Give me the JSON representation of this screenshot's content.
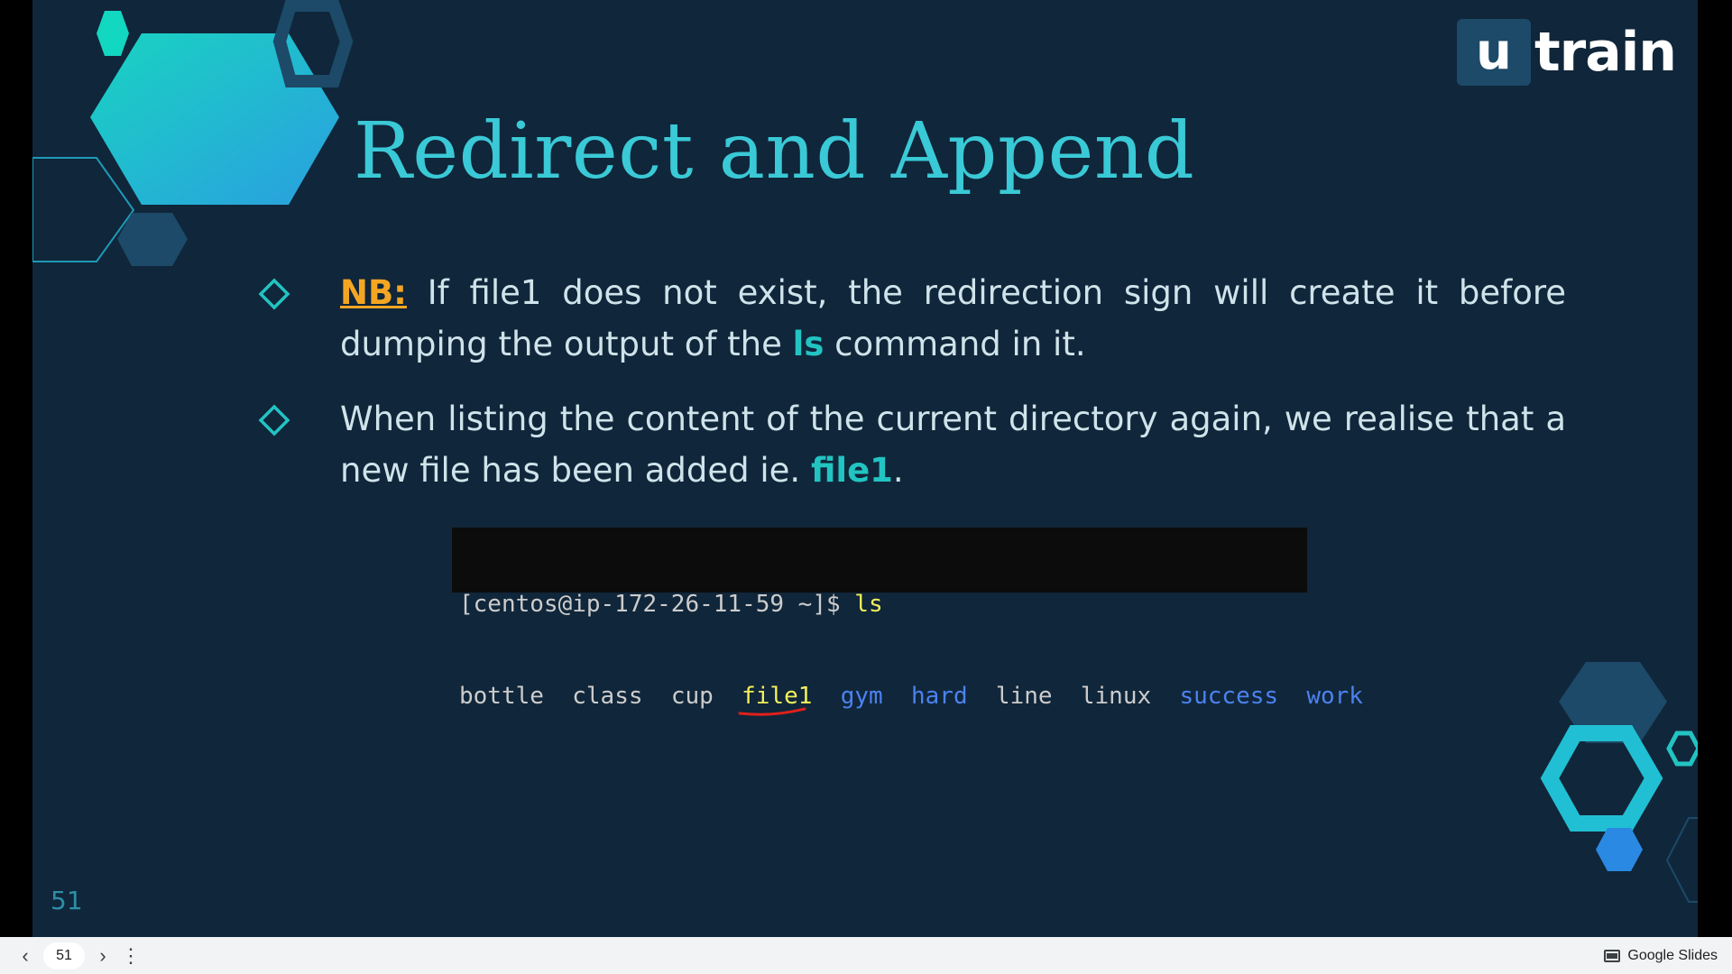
{
  "slide": {
    "logo": {
      "box_letter": "u",
      "text": "train"
    },
    "title": "Redirect and Append",
    "bullets": [
      {
        "label": "NB:",
        "text_before": " If file1 does not exist, the redirection sign will create it before dumping the output of the ",
        "highlight": "ls",
        "text_after": " command in it."
      },
      {
        "text_before": "When listing the content of the current directory again, we realise that a new file has been added ie. ",
        "highlight": "file1",
        "text_after": "."
      }
    ],
    "terminal": {
      "prompt": "[centos@ip-172-26-11-59 ~]$ ",
      "command": "ls",
      "entries": [
        {
          "name": "bottle",
          "color": "plain"
        },
        {
          "name": "class",
          "color": "plain"
        },
        {
          "name": "cup",
          "color": "plain"
        },
        {
          "name": "file1",
          "color": "yellow"
        },
        {
          "name": "gym",
          "color": "blue"
        },
        {
          "name": "hard",
          "color": "blue"
        },
        {
          "name": "line",
          "color": "plain"
        },
        {
          "name": "linux",
          "color": "plain"
        },
        {
          "name": "success",
          "color": "blue"
        },
        {
          "name": "work",
          "color": "blue"
        }
      ]
    },
    "page_number": "51"
  },
  "bottom_bar": {
    "prev_icon": "chevron-left-icon",
    "current_page": "51",
    "next_icon": "chevron-right-icon",
    "more_icon": "more-vertical-icon",
    "brand_label": "Google Slides"
  },
  "colors": {
    "background": "#10263a",
    "title": "#3ac9d6",
    "accent_teal": "#22c4c2",
    "nb_orange": "#f4a623"
  }
}
